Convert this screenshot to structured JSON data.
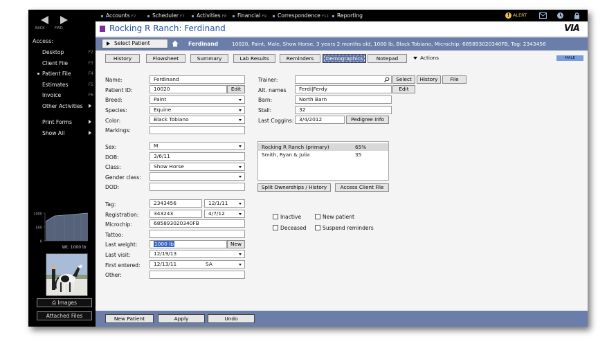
{
  "nav": {
    "back_label": "BACK",
    "fwd_label": "FWD"
  },
  "sidebar": {
    "access_label": "Access:",
    "items": [
      {
        "label": "Desktop",
        "key": "F2"
      },
      {
        "label": "Client File",
        "key": "F3"
      },
      {
        "label": "Patient File",
        "key": "F4"
      },
      {
        "label": "Estimates",
        "key": "F5"
      },
      {
        "label": "Invoice",
        "key": "F6"
      },
      {
        "label": "Other Activities",
        "key": ""
      },
      {
        "label": "Print Forms",
        "key": ""
      },
      {
        "label": "Show All",
        "key": ""
      }
    ],
    "weight_chart": {
      "ticks": [
        "1000",
        "500",
        "0"
      ],
      "caption": "Wt: 1000 lb"
    },
    "images_button": "Images",
    "attached_files_button": "Attached Files"
  },
  "topnav": {
    "items": [
      {
        "label": "Accounts",
        "key": "F2"
      },
      {
        "label": "Scheduler",
        "key": "F7"
      },
      {
        "label": "Activities",
        "key": "F8"
      },
      {
        "label": "Financial",
        "key": "F9"
      },
      {
        "label": "Correspondence",
        "key": "F11"
      },
      {
        "label": "Reporting",
        "key": ""
      }
    ],
    "alert_label": "ALERT"
  },
  "title": {
    "text": "Rocking R Ranch:   Ferdinand",
    "logo": "VIA"
  },
  "patient_bar": {
    "select_label": "Select Patient",
    "name": "Ferdinand",
    "description": "10020,  Paint,  Male,  Show Horse,  3 years 2 months old,  1000 lb,  Black Tobiano,  Microchip: 685893020340FB,  Tag: 2343456"
  },
  "tabs": [
    "History",
    "Flowsheet",
    "Summary",
    "Lab Results",
    "Reminders",
    "Demographics",
    "Notepad"
  ],
  "active_tab": "Demographics",
  "actions_label": "Actions",
  "sex_badge": "MALE",
  "form": {
    "name": {
      "label": "Name:",
      "value": "Ferdinand"
    },
    "patient_id": {
      "label": "Patient ID:",
      "value": "10020",
      "button": "Edit"
    },
    "breed": {
      "label": "Breed:",
      "value": "Paint"
    },
    "species": {
      "label": "Species:",
      "value": "Equine"
    },
    "color": {
      "label": "Color:",
      "value": "Black Tobiano"
    },
    "markings": {
      "label": "Markings:",
      "value": ""
    },
    "sex": {
      "label": "Sex:",
      "value": "M"
    },
    "dob": {
      "label": "DOB:",
      "value": "3/6/11"
    },
    "class": {
      "label": "Class:",
      "value": "Show Horse"
    },
    "gender_class": {
      "label": "Gender class:",
      "value": ""
    },
    "dod": {
      "label": "DOD:",
      "value": ""
    },
    "tag": {
      "label": "Tag:",
      "value": "2343456",
      "date": "12/1/11"
    },
    "registration": {
      "label": "Registration:",
      "value": "343243",
      "date": "4/7/12"
    },
    "microchip": {
      "label": "Microchip:",
      "value": "685893020340FB"
    },
    "tattoo": {
      "label": "Tattoo:",
      "value": ""
    },
    "last_weight": {
      "label": "Last weight:",
      "value": "1000 lb",
      "button": "New"
    },
    "last_visit": {
      "label": "Last visit:",
      "value": "12/19/13"
    },
    "first_entered": {
      "label": "First entered:",
      "value": "12/13/11",
      "user": "SA"
    },
    "other": {
      "label": "Other:",
      "value": ""
    }
  },
  "right": {
    "trainer": {
      "label": "Trainer:",
      "value": ""
    },
    "trainer_buttons": [
      "Select",
      "History",
      "File"
    ],
    "alt_names": {
      "label": "Alt. names",
      "value": "Ferdi|Ferdy",
      "button": "Edit"
    },
    "barn": {
      "label": "Barn:",
      "value": "North Barn"
    },
    "stall": {
      "label": "Stall:",
      "value": "32"
    },
    "last_coggins": {
      "label": "Last Coggins:",
      "value": "3/4/2012",
      "button": "Pedigree Info"
    },
    "owners": [
      {
        "name": "Rocking R Ranch (primary)",
        "pct": "65%"
      },
      {
        "name": "Smith, Ryan & Julia",
        "pct": "35"
      }
    ],
    "split_button": "Split Ownerships / History",
    "access_button": "Access Client File",
    "checkboxes": {
      "inactive": "Inactive",
      "new_patient": "New patient",
      "deceased": "Deceased",
      "suspend": "Suspend reminders"
    }
  },
  "bottom": {
    "new_patient": "New Patient",
    "apply": "Apply",
    "undo": "Undo"
  }
}
